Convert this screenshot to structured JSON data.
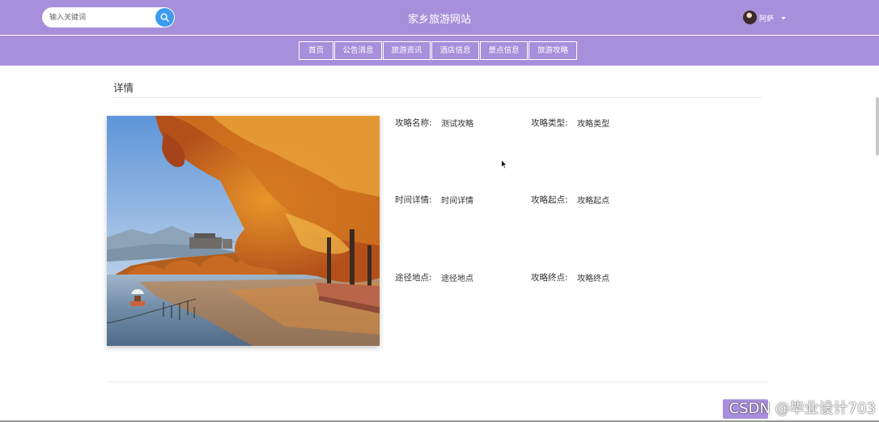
{
  "colors": {
    "accent": "#a78fdb",
    "search_button": "#3d9bf0",
    "accent_button": "#a78fdb"
  },
  "header": {
    "site_title": "家乡旅游网站",
    "search": {
      "placeholder": "输入关键词",
      "icon": "search-icon"
    },
    "user": {
      "name": "阿萨",
      "avatar_icon": "avatar"
    }
  },
  "nav": {
    "items": [
      {
        "label": "首页"
      },
      {
        "label": "公告消息"
      },
      {
        "label": "旅游资讯"
      },
      {
        "label": "酒店信息"
      },
      {
        "label": "景点信息"
      },
      {
        "label": "旅游攻略"
      }
    ]
  },
  "detail": {
    "section_title": "详情",
    "fields": [
      {
        "label": "攻略名称:",
        "value": "测试攻略"
      },
      {
        "label": "攻略类型:",
        "value": "攻略类型"
      },
      {
        "label": "时间详情:",
        "value": "时间详情"
      },
      {
        "label": "攻略起点:",
        "value": "攻略起点"
      },
      {
        "label": "途径地点:",
        "value": "途径地点"
      },
      {
        "label": "攻略终点:",
        "value": "攻略终点"
      }
    ]
  },
  "footer": {
    "watermark": "CSDN @毕业设计703"
  }
}
